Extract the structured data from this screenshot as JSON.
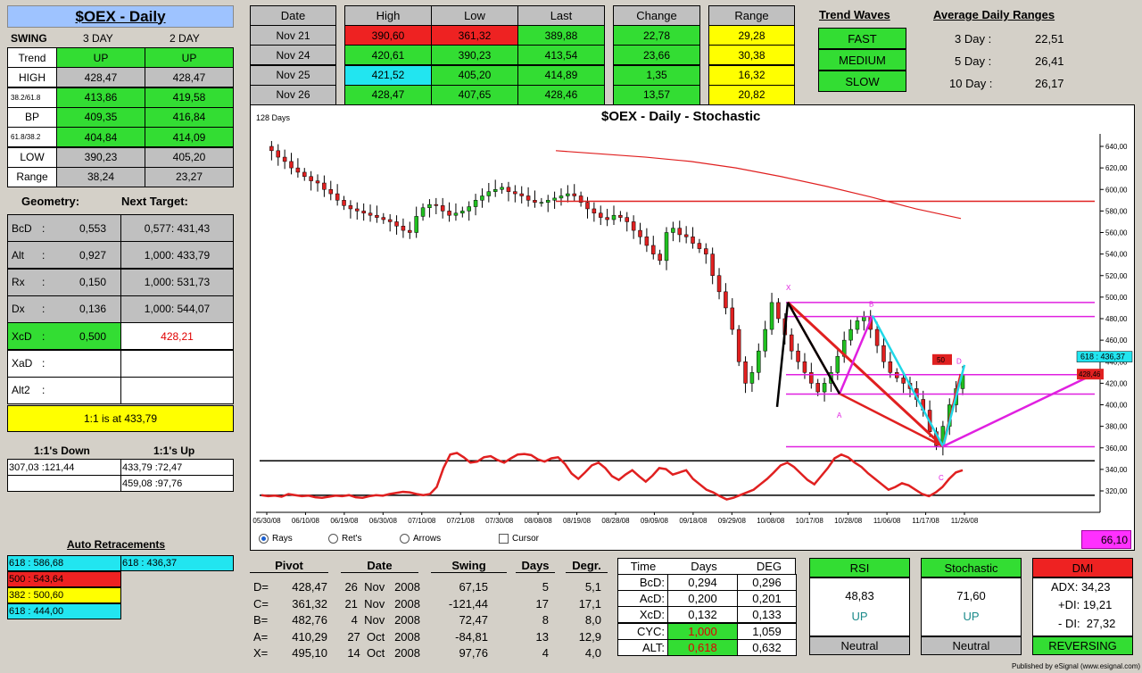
{
  "title": "$OEX - Daily",
  "swing": {
    "label": "SWING",
    "col1": "3 DAY",
    "col2": "2 DAY",
    "rows": [
      {
        "label": "Trend",
        "v1": "UP",
        "v2": "UP"
      },
      {
        "label": "HIGH",
        "v1": "428,47",
        "v2": "428,47"
      },
      {
        "label": "38.2/61.8",
        "v1": "413,86",
        "v2": "419,58"
      },
      {
        "label": "BP",
        "v1": "409,35",
        "v2": "416,84"
      },
      {
        "label": "61.8/38.2",
        "v1": "404,84",
        "v2": "414,09"
      },
      {
        "label": "LOW",
        "v1": "390,23",
        "v2": "405,20"
      },
      {
        "label": "Range",
        "v1": "38,24",
        "v2": "23,27"
      }
    ]
  },
  "geometry": {
    "label": "Geometry:",
    "next_label": "Next Target:",
    "rows": [
      {
        "name": "BcD",
        "val": "0,553",
        "target": "0,577: 431,43"
      },
      {
        "name": "Alt",
        "val": "0,927",
        "target": "1,000: 433,79"
      },
      {
        "name": "Rx",
        "val": "0,150",
        "target": "1,000: 531,73"
      },
      {
        "name": "Dx",
        "val": "0,136",
        "target": "1,000: 544,07"
      },
      {
        "name": "XcD",
        "val": "0,500",
        "target": "428,21"
      },
      {
        "name": "XaD",
        "val": "",
        "target": ""
      },
      {
        "name": "Alt2",
        "val": "",
        "target": ""
      }
    ],
    "colon": ":",
    "one_to_one": "1:1 is at 433,79"
  },
  "ones": {
    "down_label": "1:1's Down",
    "up_label": "1:1's Up",
    "down": [
      "307,03 :121,44",
      ""
    ],
    "up": [
      "433,79 :72,47",
      "459,08 :97,76"
    ]
  },
  "auto_retracements": {
    "label": "Auto Retracements",
    "left": [
      {
        "text": "618 : 586,68",
        "color": "#22e5f0"
      },
      {
        "text": "500 : 543,64",
        "color": "#ee2222"
      },
      {
        "text": "382 : 500,60",
        "color": "#ffff00"
      },
      {
        "text": "618 : 444,00",
        "color": "#22e5f0"
      }
    ],
    "right": [
      {
        "text": "618 : 436,37",
        "color": "#22e5f0"
      }
    ]
  },
  "prices": {
    "headers": [
      "Date",
      "High",
      "Low",
      "Last",
      "Change",
      "Range"
    ],
    "rows": [
      {
        "date": "Nov  21",
        "high": "390,60",
        "low": "361,32",
        "last": "389,88",
        "change": "22,78",
        "range": "29,28",
        "hc": "#ee2222",
        "lc": "#ee2222"
      },
      {
        "date": "Nov  24",
        "high": "420,61",
        "low": "390,23",
        "last": "413,54",
        "change": "23,66",
        "range": "30,38",
        "hc": "#33dd33",
        "lc": "#33dd33"
      },
      {
        "date": "Nov  25",
        "high": "421,52",
        "low": "405,20",
        "last": "414,89",
        "change": "1,35",
        "range": "16,32",
        "hc": "#22e5f0",
        "lc": "#33dd33"
      },
      {
        "date": "Nov  26",
        "high": "428,47",
        "low": "407,65",
        "last": "428,46",
        "change": "13,57",
        "range": "20,82",
        "hc": "#33dd33",
        "lc": "#33dd33"
      }
    ]
  },
  "trend_waves": {
    "label": "Trend Waves",
    "items": [
      "FAST",
      "MEDIUM",
      "SLOW"
    ]
  },
  "adr": {
    "label": "Average Daily Ranges",
    "rows": [
      {
        "k": "3 Day :",
        "v": "22,51"
      },
      {
        "k": "5 Day :",
        "v": "26,41"
      },
      {
        "k": "10 Day :",
        "v": "26,17"
      }
    ]
  },
  "chart_panel": {
    "days": "128 Days",
    "title": "$OEX - Daily - Stochastic",
    "radios": [
      "Rays",
      "Ret's",
      "Arrows"
    ],
    "cursor": "Cursor",
    "stoch_value": "66,10",
    "label_618": "618 : 436,37",
    "label_2846": "428,46",
    "label_50": "50",
    "price_4x": "4x",
    "pt_labels": {
      "x": "X",
      "a": "A",
      "b": "B",
      "c": "C",
      "d": "D"
    }
  },
  "chart_data": {
    "type": "candlestick",
    "title": "$OEX - Daily - Stochastic",
    "ylim": [
      300,
      650
    ],
    "yticks": [
      320,
      340,
      360,
      380,
      400,
      420,
      440,
      460,
      480,
      500,
      520,
      540,
      560,
      580,
      600,
      620,
      640
    ],
    "x_tick_labels": [
      "05/30/08",
      "06/10/08",
      "06/19/08",
      "06/30/08",
      "07/10/08",
      "07/21/08",
      "07/30/08",
      "08/08/08",
      "08/19/08",
      "08/28/08",
      "09/09/08",
      "09/18/08",
      "09/29/08",
      "10/08/08",
      "10/17/08",
      "10/28/08",
      "11/06/08",
      "11/17/08",
      "11/26/08"
    ],
    "moving_average": [
      636,
      633,
      630,
      626,
      620,
      612,
      603,
      593,
      582,
      573
    ],
    "horizontal_levels": [
      {
        "value": 589,
        "color": "#e02020"
      },
      {
        "value": 495,
        "color": "#e020e0"
      },
      {
        "value": 482,
        "color": "#e020e0"
      },
      {
        "value": 428,
        "color": "#e020e0"
      },
      {
        "value": 410,
        "color": "#e020e0"
      },
      {
        "value": 361,
        "color": "#e020e0"
      }
    ],
    "pattern_points": {
      "X": 495.1,
      "A": 410.29,
      "B": 482.76,
      "C": 361.32,
      "D": 428.47
    },
    "stochastic": {
      "upper": 80,
      "lower": 20
    }
  },
  "pivots": {
    "headers": [
      "Pivot",
      "Date",
      "Swing",
      "Days",
      "Degr."
    ],
    "rows": [
      {
        "p": "D=",
        "v": "428,47",
        "date": "26  Nov   2008",
        "swing": "67,15",
        "days": "5",
        "deg": "5,1"
      },
      {
        "p": "C=",
        "v": "361,32",
        "date": "21  Nov   2008",
        "swing": "-121,44",
        "days": "17",
        "deg": "17,1"
      },
      {
        "p": "B=",
        "v": "482,76",
        "date": "4  Nov   2008",
        "swing": "72,47",
        "days": "8",
        "deg": "8,0"
      },
      {
        "p": "A=",
        "v": "410,29",
        "date": "27  Oct   2008",
        "swing": "-84,81",
        "days": "13",
        "deg": "12,9"
      },
      {
        "p": "X=",
        "v": "495,10",
        "date": "14  Oct   2008",
        "swing": "97,76",
        "days": "4",
        "deg": "4,0"
      }
    ]
  },
  "time": {
    "headers": [
      "Time",
      "Days",
      "DEG"
    ],
    "rows": [
      {
        "k": "BcD:",
        "d": "0,294",
        "g": "0,296",
        "c": ""
      },
      {
        "k": "AcD:",
        "d": "0,200",
        "g": "0,201",
        "c": ""
      },
      {
        "k": "XcD:",
        "d": "0,132",
        "g": "0,133",
        "c": ""
      },
      {
        "k": "CYC:",
        "d": "1,000",
        "g": "1,059",
        "c": "#33dd33"
      },
      {
        "k": "ALT:",
        "d": "0,618",
        "g": "0,632",
        "c": "#33dd33"
      }
    ]
  },
  "rsi": {
    "label": "RSI",
    "value": "48,83",
    "dir": "UP",
    "state": "Neutral"
  },
  "stoch": {
    "label": "Stochastic",
    "value": "71,60",
    "dir": "UP",
    "state": "Neutral"
  },
  "dmi": {
    "label": "DMI",
    "adx": "ADX:  34,23",
    "pdi": "+DI:  19,21",
    "mdi": "- DI:  27,32",
    "state": "REVERSING"
  },
  "footer": "Published by eSignal (www.esignal.com)"
}
